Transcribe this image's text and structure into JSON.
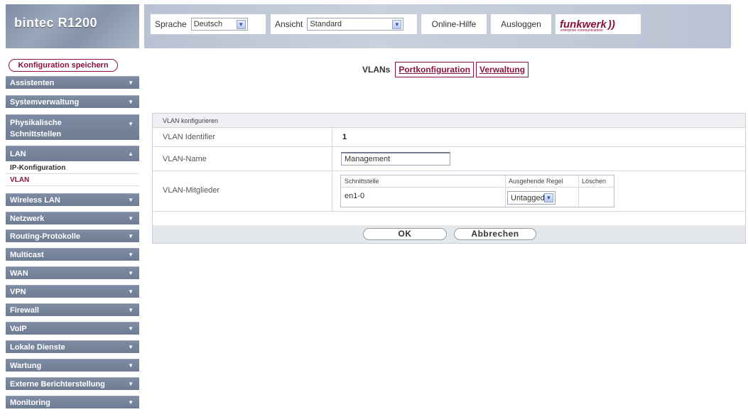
{
  "header": {
    "brand": "bintec R1200",
    "language_label": "Sprache",
    "language_value": "Deutsch",
    "view_label": "Ansicht",
    "view_value": "Standard",
    "online_help": "Online-Hilfe",
    "logout": "Ausloggen",
    "logo": "funkwerk",
    "logo_tagline": "enterprise communications"
  },
  "sidebar": {
    "save_button": "Konfiguration speichern",
    "items": [
      {
        "label": "Assistenten",
        "arrow": "down"
      },
      {
        "label": "Systemverwaltung",
        "arrow": "down"
      },
      {
        "label": "Physikalische Schnittstellen",
        "line1": "Physikalische",
        "line2": "Schnittstellen",
        "arrow": "down"
      },
      {
        "label": "LAN",
        "arrow": "up"
      },
      {
        "label": "Wireless LAN",
        "arrow": "down"
      },
      {
        "label": "Netzwerk",
        "arrow": "down"
      },
      {
        "label": "Routing-Protokolle",
        "arrow": "down"
      },
      {
        "label": "Multicast",
        "arrow": "down"
      },
      {
        "label": "WAN",
        "arrow": "down"
      },
      {
        "label": "VPN",
        "arrow": "down"
      },
      {
        "label": "Firewall",
        "arrow": "down"
      },
      {
        "label": "VoIP",
        "arrow": "down"
      },
      {
        "label": "Lokale Dienste",
        "arrow": "down"
      },
      {
        "label": "Wartung",
        "arrow": "down"
      },
      {
        "label": "Externe Berichterstellung",
        "arrow": "down"
      },
      {
        "label": "Monitoring",
        "arrow": "down"
      }
    ],
    "lan_subitems": [
      {
        "label": "IP-Konfiguration",
        "active": false
      },
      {
        "label": "VLAN",
        "active": true
      }
    ]
  },
  "tabs": [
    {
      "label": "VLANs",
      "active": true
    },
    {
      "label": "Portkonfiguration",
      "active": false
    },
    {
      "label": "Verwaltung",
      "active": false
    }
  ],
  "form": {
    "section_title": "VLAN konfigurieren",
    "vlan_id_label": "VLAN Identifier",
    "vlan_id_value": "1",
    "vlan_name_label": "VLAN-Name",
    "vlan_name_value": "Management",
    "members_label": "VLAN-Mitglieder",
    "members_table": {
      "headers": [
        "Schnittstelle",
        "Ausgehende Regel",
        "Löschen"
      ],
      "rows": [
        {
          "interface": "en1-0",
          "rule": "Untagged",
          "delete": ""
        }
      ]
    },
    "ok_button": "OK",
    "cancel_button": "Abbrechen"
  },
  "colors": {
    "accent": "#8a1538",
    "nav_bg": "#75839b",
    "header_bg": "#c2cbd9"
  },
  "icons": {
    "dropdown": "chevron-down-icon",
    "nav_down": "triangle-down-icon",
    "nav_up": "triangle-up-icon"
  }
}
